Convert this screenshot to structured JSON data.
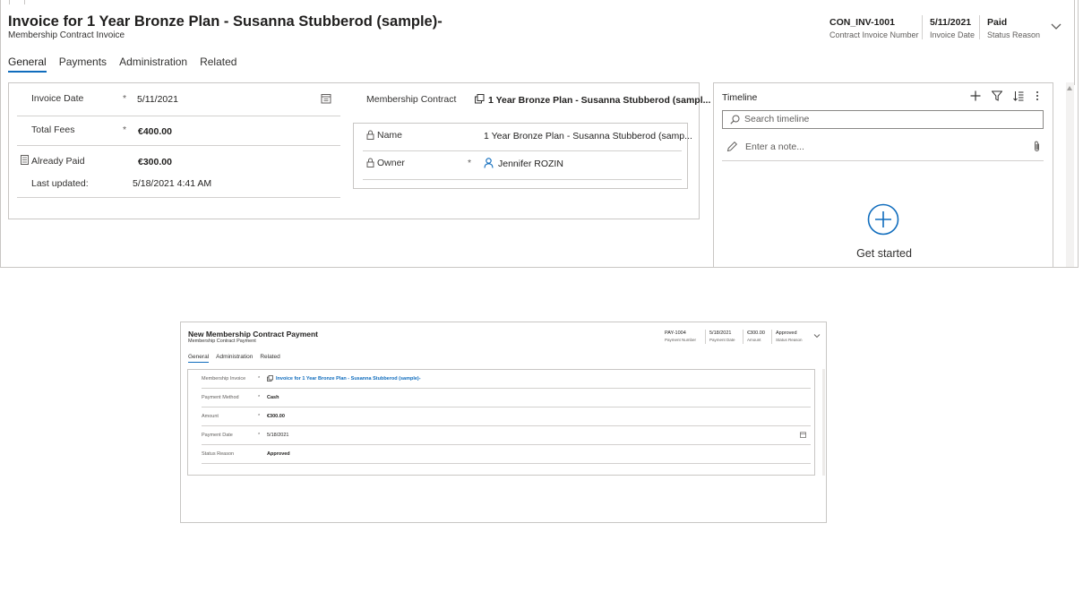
{
  "invoice_form": {
    "title": "Invoice for 1 Year Bronze Plan - Susanna Stubberod (sample)-",
    "entity": "Membership Contract Invoice",
    "header_fields": [
      {
        "value": "CON_INV-1001",
        "label": "Contract Invoice Number"
      },
      {
        "value": "5/11/2021",
        "label": "Invoice Date"
      },
      {
        "value": "Paid",
        "label": "Status Reason"
      }
    ],
    "tabs": [
      "General",
      "Payments",
      "Administration",
      "Related"
    ],
    "active_tab": "General",
    "fields": {
      "invoice_date": {
        "label": "Invoice Date",
        "required": "*",
        "value": "5/11/2021"
      },
      "total_fees": {
        "label": "Total Fees",
        "required": "*",
        "value": "€400.00"
      },
      "already_paid": {
        "label": "Already Paid",
        "value": "€300.00"
      },
      "last_updated": {
        "label": "Last updated:",
        "value": "5/18/2021 4:41 AM"
      },
      "membership_contract": {
        "label": "Membership Contract",
        "value": "1 Year Bronze Plan - Susanna Stubberod (sampl..."
      },
      "name": {
        "label": "Name",
        "value": "1 Year Bronze Plan - Susanna Stubberod (samp..."
      },
      "owner": {
        "label": "Owner",
        "required": "*",
        "value": "Jennifer ROZIN"
      }
    },
    "timeline": {
      "title": "Timeline",
      "search_placeholder": "Search timeline",
      "note_placeholder": "Enter a note...",
      "empty_text": "Get started"
    }
  },
  "payment_form": {
    "title": "New Membership Contract Payment",
    "entity": "Membership Contract Payment",
    "header_fields": [
      {
        "value": "PAY-1004",
        "label": "Payment Number"
      },
      {
        "value": "5/18/2021",
        "label": "Payment Date"
      },
      {
        "value": "€300.00",
        "label": "Amount"
      },
      {
        "value": "Approved",
        "label": "Status Reason"
      }
    ],
    "tabs": [
      "General",
      "Administration",
      "Related"
    ],
    "active_tab": "General",
    "fields": [
      {
        "label": "Membership Invoice",
        "required": "*",
        "value": "Invoice for 1 Year Bronze Plan - Susanna Stubberod (sample)-"
      },
      {
        "label": "Payment Method",
        "required": "*",
        "value": "Cash"
      },
      {
        "label": "Amount",
        "required": "*",
        "value": "€300.00"
      },
      {
        "label": "Payment Date",
        "required": "*",
        "value": "5/18/2021"
      },
      {
        "label": "Status Reason",
        "required": "",
        "value": "Approved"
      }
    ]
  },
  "colors": {
    "accent": "#0f6cbd",
    "border": "#c8c6c4",
    "text": "#323130"
  },
  "icons": [
    "calendar-icon",
    "calculator-icon",
    "lookup-record-icon",
    "lock-icon",
    "person-icon",
    "add-icon",
    "filter-icon",
    "sort-icon",
    "more-icon",
    "search-icon",
    "pencil-icon",
    "paperclip-icon",
    "add-circle-icon",
    "chevron-down-icon"
  ]
}
